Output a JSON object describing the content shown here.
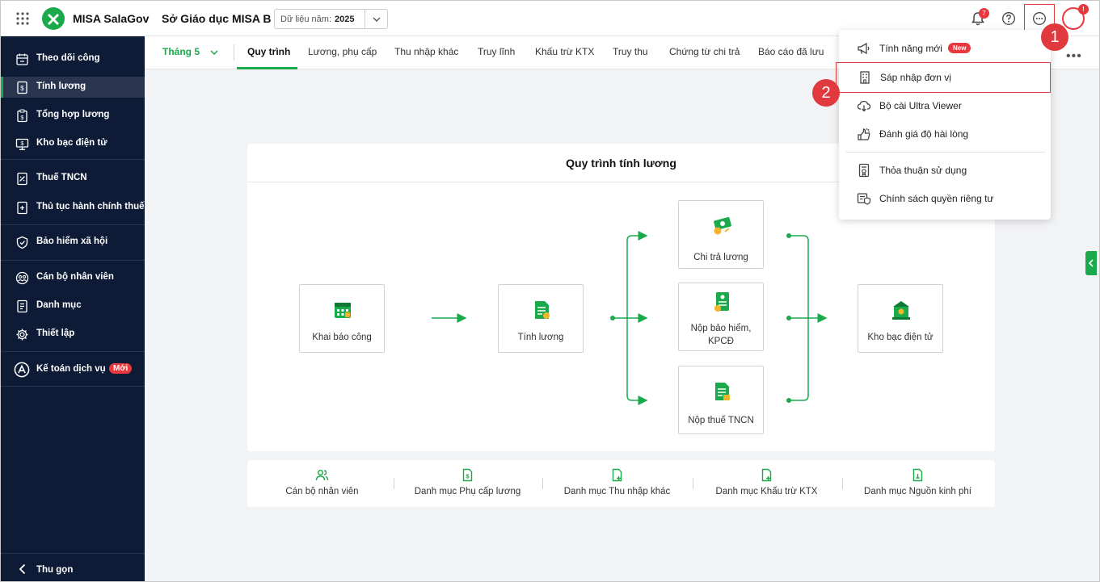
{
  "topbar": {
    "brand": "MISA SalaGov",
    "org": "Sở Giáo dục MISA B",
    "year_label": "Dữ liệu năm:",
    "year_value": "2025",
    "notif_count": "7",
    "avatar_badge": "!"
  },
  "sidebar": {
    "items": [
      {
        "label": "Theo dõi công",
        "icon": "calendar-icon"
      },
      {
        "label": "Tính lương",
        "icon": "payroll-icon"
      },
      {
        "label": "Tổng hợp lương",
        "icon": "summary-icon"
      },
      {
        "label": "Kho bạc điện tử",
        "icon": "treasury-icon"
      },
      {
        "label": "Thuế TNCN",
        "icon": "tax-icon"
      },
      {
        "label": "Thủ tục hành chính thuế",
        "icon": "tax-procedure-icon"
      },
      {
        "label": "Bảo hiểm xã hội",
        "icon": "insurance-icon"
      },
      {
        "label": "Cán bộ nhân viên",
        "icon": "staff-icon"
      },
      {
        "label": "Danh mục",
        "icon": "catalog-icon"
      },
      {
        "label": "Thiết lập",
        "icon": "gear-icon"
      },
      {
        "label": "Kế toán dịch vụ",
        "icon": "accounting-icon"
      }
    ],
    "new_badge": "Mới",
    "collapse_label": "Thu gọn"
  },
  "tabs": {
    "month": "Tháng 5",
    "items": [
      "Quy trình",
      "Lương, phụ cấp",
      "Thu nhập khác",
      "Truy lĩnh",
      "Khấu trừ KTX",
      "Truy thu",
      "Chứng từ chi trả",
      "Báo cáo đã lưu"
    ],
    "more": "•••"
  },
  "process": {
    "title": "Quy trình tính lương",
    "nodes": {
      "khai_bao_cong": "Khai báo công",
      "tinh_luong": "Tính lương",
      "chi_tra_luong": "Chi trả lương",
      "nop_bao_hiem_1": "Nộp bảo hiểm,",
      "nop_bao_hiem_2": "KPCĐ",
      "nop_thue": "Nộp thuế TNCN",
      "kho_bac": "Kho bạc điện tử"
    }
  },
  "shortcuts": [
    "Cán bộ nhân viên",
    "Danh mục Phụ cấp lương",
    "Danh mục Thu nhập khác",
    "Danh mục Khấu trừ KTX",
    "Danh mục Nguồn kinh phí"
  ],
  "dropdown": {
    "items": [
      {
        "label": "Tính năng mới",
        "icon": "megaphone-icon"
      },
      {
        "label": "Sáp nhập đơn vị",
        "icon": "building-icon"
      },
      {
        "label": "Bộ cài Ultra Viewer",
        "icon": "cloud-download-icon"
      },
      {
        "label": "Đánh giá độ hài lòng",
        "icon": "rating-icon"
      },
      {
        "label": "Thỏa thuận sử dụng",
        "icon": "agreement-icon"
      },
      {
        "label": "Chính sách quyền riêng tư",
        "icon": "privacy-icon"
      }
    ],
    "new_badge": "New"
  },
  "steps": [
    "1",
    "2"
  ],
  "colors": {
    "accent": "#1aaa4b",
    "sidebar_bg": "#0d1b36",
    "highlight": "#e03d3d"
  }
}
